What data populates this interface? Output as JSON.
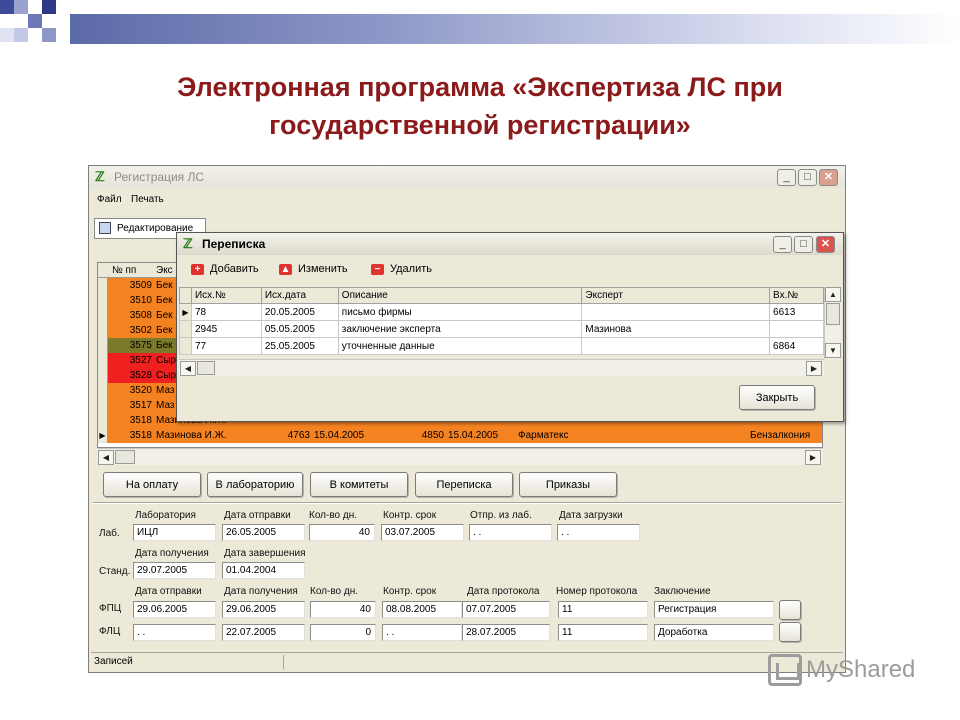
{
  "slide": {
    "title_line1": "Электронная программа «Экспертиза ЛС при",
    "title_line2": "государственной регистрации»"
  },
  "main_window": {
    "title": "Регистрация ЛС",
    "menu": [
      "Файл",
      "Печать"
    ],
    "toolbar": [
      "Редактирование"
    ],
    "grid_headers": [
      "№ пп",
      "Экс"
    ],
    "rows": [
      {
        "num": "3509",
        "expert": "Бек",
        "color": "#f58220"
      },
      {
        "num": "3510",
        "expert": "Бек",
        "color": "#f58220"
      },
      {
        "num": "3508",
        "expert": "Бек",
        "color": "#f58220"
      },
      {
        "num": "3502",
        "expert": "Бек",
        "color": "#f58220"
      },
      {
        "num": "3575",
        "expert": "Бек",
        "color": "#7a7a2a"
      },
      {
        "num": "3527",
        "expert": "Сыр",
        "color": "#ee2020"
      },
      {
        "num": "3528",
        "expert": "Сыр",
        "color": "#ee2020"
      },
      {
        "num": "3520",
        "expert": "Маз",
        "color": "#f58220"
      },
      {
        "num": "3517",
        "expert": "Маз",
        "color": "#f58220"
      },
      {
        "num": "3518",
        "expert": "Мазинова И.Ж.",
        "color": "#f58220"
      },
      {
        "num": "3518",
        "expert": "Мазинова И.Ж.",
        "c3": "4763",
        "c4": "15.04.2005",
        "c5": "4850",
        "c6": "15.04.2005",
        "c7": "Фарматекс",
        "c8": "Бензалкония",
        "color": "#f58220"
      }
    ],
    "buttons": [
      "На оплату",
      "В лабораторию",
      "В комитеты",
      "Переписка",
      "Приказы"
    ],
    "lab": {
      "row_label": "Лаб.",
      "headers": [
        "Лаборатория",
        "Дата отправки",
        "Кол-во дн.",
        "Контр. срок",
        "Отпр. из лаб.",
        "Дата загрузки"
      ],
      "values": [
        "ИЦЛ",
        "26.05.2005",
        "40",
        "03.07.2005",
        ". .",
        ". ."
      ]
    },
    "stand": {
      "row_label": "Станд.",
      "headers": [
        "Дата получения",
        "Дата завершения"
      ],
      "values": [
        "29.07.2005",
        "01.04.2004"
      ]
    },
    "pharm": {
      "headers": [
        "Дата отправки",
        "Дата получения",
        "Кол-во дн.",
        "Контр. срок",
        "Дата протокола",
        "Номер протокола",
        "Заключение"
      ],
      "rows": [
        {
          "label": "ФПЦ",
          "values": [
            "29.06.2005",
            "29.06.2005",
            "40",
            "08.08.2005",
            "07.07.2005",
            "11",
            "Регистрация"
          ]
        },
        {
          "label": "ФЛЦ",
          "values": [
            ". .",
            "22.07.2005",
            "0",
            ". .",
            "28.07.2005",
            "11",
            "Доработка"
          ]
        }
      ]
    },
    "status": "Записей"
  },
  "popup": {
    "title": "Переписка",
    "toolbar": [
      "Добавить",
      "Изменить",
      "Удалить"
    ],
    "headers": [
      "Исх.№",
      "Исх.дата",
      "Описание",
      "Эксперт",
      "Вх.№"
    ],
    "rows": [
      [
        "78",
        "20.05.2005",
        "письмо фирмы",
        "",
        "6613"
      ],
      [
        "2945",
        "05.05.2005",
        "заключение эксперта",
        "Мазинова",
        ""
      ],
      [
        "77",
        "25.05.2005",
        "уточненные данные",
        "",
        "6864"
      ]
    ],
    "close_label": "Закрыть"
  },
  "watermark": "MyShared"
}
